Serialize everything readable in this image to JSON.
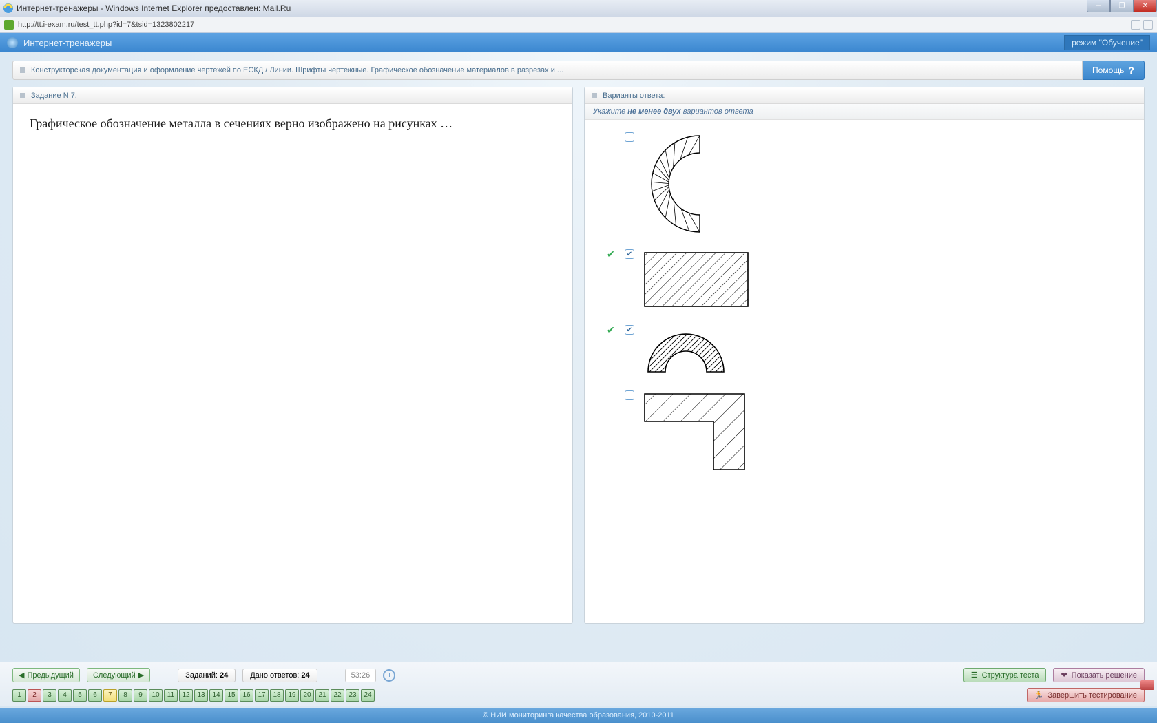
{
  "window": {
    "title": "Интернет-тренажеры - Windows Internet Explorer предоставлен: Mail.Ru",
    "url": "http://tt.i-exam.ru/test_tt.php?id=7&tsid=1323802217"
  },
  "header": {
    "title": "Интернет-тренажеры",
    "mode": "режим \"Обучение\""
  },
  "breadcrumb": "Конструкторская документация и оформление чертежей по ЕСКД / Линии. Шрифты чертежные. Графическое обозначение материалов в разрезах и ...",
  "help_label": "Помощь",
  "question": {
    "header": "Задание N 7.",
    "text": "Графическое обозначение металла в сечениях верно изображено на рисунках …"
  },
  "answers": {
    "header": "Варианты ответа:",
    "instruction_prefix": "Укажите ",
    "instruction_bold": "не менее двух",
    "instruction_suffix": " вариантов ответа",
    "items": [
      {
        "checked": false,
        "correct": false
      },
      {
        "checked": true,
        "correct": true
      },
      {
        "checked": true,
        "correct": true
      },
      {
        "checked": false,
        "correct": false
      }
    ]
  },
  "footer": {
    "prev": "Предыдущий",
    "next": "Следующий",
    "tasks_label": "Заданий:",
    "tasks_value": "24",
    "answered_label": "Дано ответов:",
    "answered_value": "24",
    "timer": "53:26",
    "structure": "Структура теста",
    "show_solution": "Показать решение",
    "finish": "Завершить тестирование"
  },
  "pager": {
    "items": [
      "1",
      "2",
      "3",
      "4",
      "5",
      "6",
      "7",
      "8",
      "9",
      "10",
      "11",
      "12",
      "13",
      "14",
      "15",
      "16",
      "17",
      "18",
      "19",
      "20",
      "21",
      "22",
      "23",
      "24"
    ],
    "current": "7",
    "red": [
      "2"
    ]
  },
  "copyright": "© НИИ мониторинга качества образования, 2010-2011"
}
